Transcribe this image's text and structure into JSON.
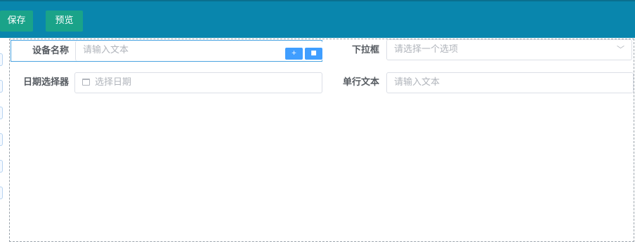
{
  "toolbar": {
    "save_label": "保存",
    "preview_label": "预览"
  },
  "form": {
    "device_name": {
      "label": "设备名称",
      "placeholder": "请输入文本"
    },
    "dropdown": {
      "label": "下拉框",
      "placeholder": "请选择一个选项"
    },
    "date_picker": {
      "label": "日期选择器",
      "placeholder": "选择日期"
    },
    "single_text": {
      "label": "单行文本",
      "placeholder": "请输入文本"
    }
  },
  "actions": {
    "copy_icon": "plus-icon",
    "delete_icon": "trash-icon"
  },
  "colors": {
    "header_bg": "#0986ad",
    "button_bg": "#1aa389",
    "accent": "#409eff"
  }
}
